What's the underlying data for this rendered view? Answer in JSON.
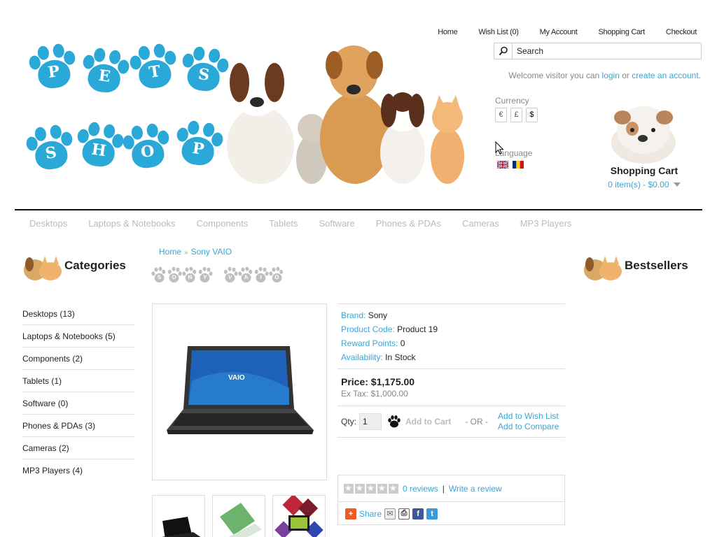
{
  "top_nav": {
    "home": "Home",
    "wishlist": "Wish List (0)",
    "account": "My Account",
    "cart": "Shopping Cart",
    "checkout": "Checkout"
  },
  "search": {
    "value": "Search"
  },
  "welcome": {
    "prefix": "Welcome visitor you can ",
    "login": "login",
    "or": " or ",
    "create": "create an account",
    "suffix": "."
  },
  "logo": {
    "letters_line1": [
      "P",
      "E",
      "T",
      "S"
    ],
    "letters_line2": [
      "S",
      "H",
      "O",
      "P"
    ]
  },
  "currency": {
    "label": "Currency",
    "options": [
      "€",
      "£",
      "$"
    ],
    "selected": "$"
  },
  "language": {
    "label": "Language",
    "flags": [
      "english-flag",
      "romanian-flag"
    ]
  },
  "cart": {
    "title": "Shopping Cart",
    "summary": "0 item(s) - $0.00"
  },
  "menu": [
    "Desktops",
    "Laptops & Notebooks",
    "Components",
    "Tablets",
    "Software",
    "Phones & PDAs",
    "Cameras",
    "MP3 Players"
  ],
  "left_column": {
    "title": "Categories",
    "items": [
      "Desktops (13)",
      "Laptops & Notebooks (5)",
      "Components (2)",
      "Tablets (1)",
      "Software (0)",
      "Phones & PDAs (3)",
      "Cameras (2)",
      "MP3 Players (4)"
    ]
  },
  "right_column": {
    "title": "Bestsellers"
  },
  "breadcrumb": {
    "home": "Home",
    "current": "Sony VAIO",
    "separator": "»"
  },
  "product_title_letters": [
    "S",
    "O",
    "N",
    "Y",
    " ",
    "V",
    "A",
    "I",
    "O"
  ],
  "product": {
    "brand_label": "Brand:",
    "brand": "Sony",
    "code_label": "Product Code:",
    "code": "Product 19",
    "points_label": "Reward Points:",
    "points": "0",
    "availability_label": "Availability:",
    "availability": "In Stock",
    "price": "Price: $1,175.00",
    "ex_tax": "Ex Tax: $1,000.00",
    "qty_label": "Qty:",
    "qty_value": "1",
    "add_to_cart": "Add to Cart",
    "or": "- OR -",
    "add_to_wishlist": "Add to Wish List",
    "add_to_compare": "Add to Compare",
    "rating": 0,
    "reviews": "0 reviews",
    "write_review": "Write a review",
    "share": "Share"
  },
  "colors": {
    "accent": "#38a6d6",
    "paw_blue": "#2aa9d8",
    "menu_text": "#bbbbbb"
  }
}
